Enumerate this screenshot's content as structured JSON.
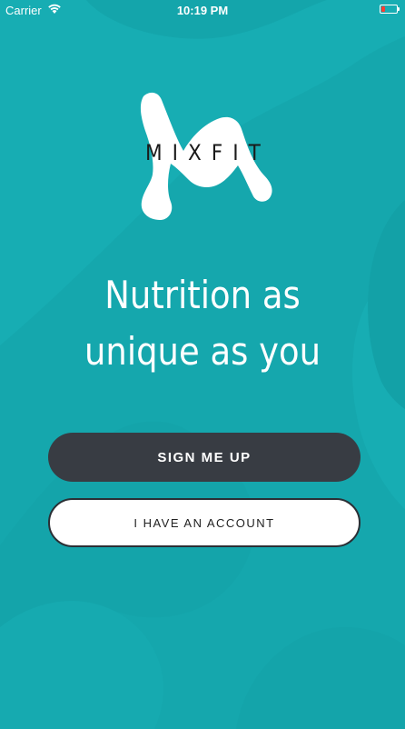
{
  "status_bar": {
    "carrier": "Carrier",
    "time": "10:19 PM",
    "wifi_icon": "wifi-icon",
    "battery_icon": "battery-low-icon",
    "battery_color": "#ff3b30"
  },
  "logo": {
    "text": "MIXFIT",
    "icon": "mixfit-m-splash-logo"
  },
  "headline": {
    "line1": "Nutrition as",
    "line2": "unique as you"
  },
  "buttons": {
    "sign_up_label": "SIGN ME UP",
    "account_label": "I HAVE AN ACCOUNT"
  },
  "colors": {
    "background": "#17adb3",
    "primary_button": "#383c43",
    "secondary_button": "#ffffff"
  }
}
